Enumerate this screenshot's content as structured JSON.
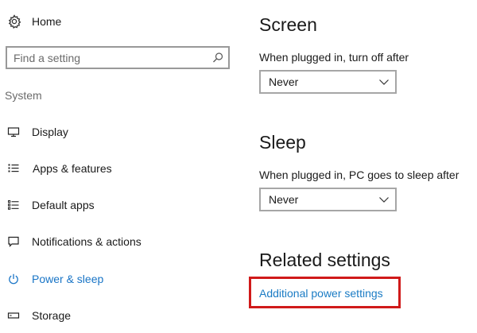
{
  "sidebar": {
    "home_label": "Home",
    "search": {
      "placeholder": "Find a setting",
      "value": ""
    },
    "section_label": "System",
    "items": [
      {
        "label": "Display",
        "icon": "monitor-icon"
      },
      {
        "label": "Apps & features",
        "icon": "apps-list-icon"
      },
      {
        "label": "Default apps",
        "icon": "default-apps-icon"
      },
      {
        "label": "Notifications & actions",
        "icon": "notification-icon"
      },
      {
        "label": "Power & sleep",
        "icon": "power-icon",
        "active": true
      },
      {
        "label": "Storage",
        "icon": "storage-icon"
      }
    ],
    "accent_color": "#1874c6"
  },
  "main": {
    "screen": {
      "heading": "Screen",
      "field_label": "When plugged in, turn off after",
      "selected": "Never"
    },
    "sleep": {
      "heading": "Sleep",
      "field_label": "When plugged in, PC goes to sleep after",
      "selected": "Never"
    },
    "related": {
      "heading": "Related settings",
      "link_label": "Additional power settings",
      "highlight_color": "#d01a1a"
    }
  }
}
